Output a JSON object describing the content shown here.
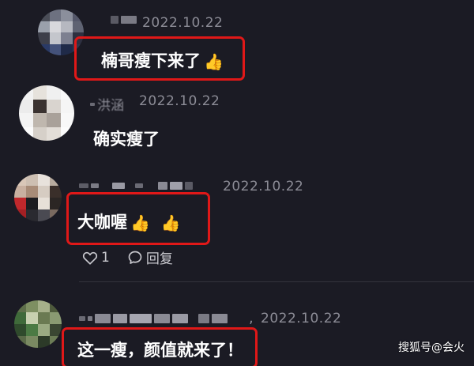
{
  "comments": [
    {
      "date": "2022.10.22",
      "text": "楠哥瘦下来了",
      "reactions": [
        "👍"
      ]
    },
    {
      "username_partial": "洪涵",
      "date": "2022.10.22",
      "text": "确实瘦了"
    },
    {
      "date": "2022.10.22",
      "text": "大咖喔",
      "reactions": [
        "👍",
        "👍"
      ],
      "like_count": "1",
      "reply_label": "回复"
    },
    {
      "date": "2022.10.22",
      "separator": ",",
      "text": "这一瘦，颜值就来了！"
    }
  ],
  "watermark": "搜狐号@会火",
  "colors": {
    "background": "#1b1b24",
    "highlight_border": "#e01818",
    "date_text": "#8c8c96",
    "comment_text": "#ffffff"
  },
  "icons": {
    "like": "heart-outline-icon",
    "reply": "speech-bubble-icon",
    "reaction": "thumbs-up-emoji"
  }
}
